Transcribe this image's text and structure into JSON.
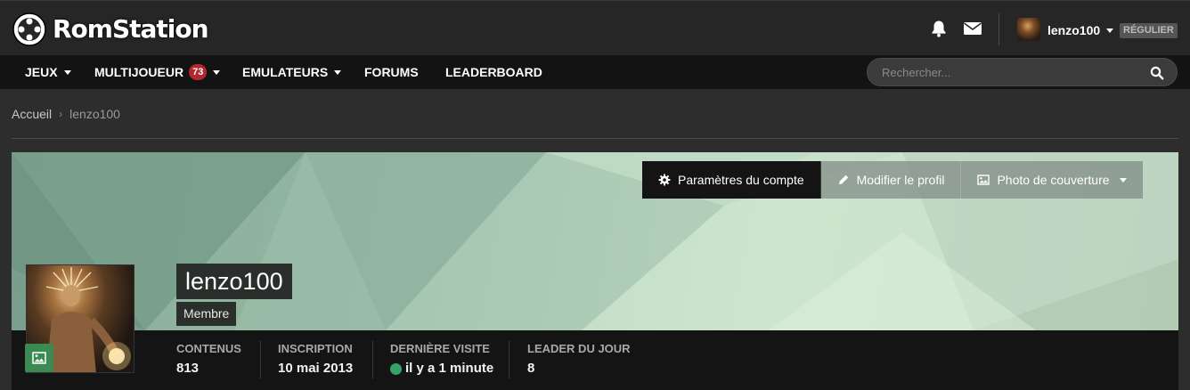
{
  "header": {
    "brand": "RomStation",
    "user_name": "lenzo100",
    "user_badge": "RÉGULIER"
  },
  "nav": {
    "items": [
      {
        "label": "JEUX",
        "has_dropdown": true
      },
      {
        "label": "MULTIJOUEUR",
        "badge": "73",
        "has_dropdown": true
      },
      {
        "label": "EMULATEURS",
        "has_dropdown": true
      },
      {
        "label": "FORUMS",
        "has_dropdown": false
      },
      {
        "label": "LEADERBOARD",
        "has_dropdown": false
      }
    ],
    "search_placeholder": "Rechercher..."
  },
  "breadcrumb": {
    "home": "Accueil",
    "current": "lenzo100"
  },
  "profile": {
    "name": "lenzo100",
    "role": "Membre",
    "actions": {
      "account_settings": "Paramètres du compte",
      "edit_profile": "Modifier le profil",
      "cover_photo": "Photo de couverture"
    },
    "stats": [
      {
        "label": "CONTENUS",
        "value": "813"
      },
      {
        "label": "INSCRIPTION",
        "value": "10 mai 2013"
      },
      {
        "label": "DERNIÈRE VISITE",
        "value": "il y a 1 minute"
      },
      {
        "label": "LEADER DU JOUR",
        "value": "8"
      }
    ]
  },
  "colors": {
    "accent_green": "#3a8a52",
    "badge_red": "#b3282d",
    "online": "#35a26a",
    "nav_bg": "#131313",
    "header_bg": "#262626"
  },
  "icons": {
    "logo": "gamepad-ring-icon",
    "notifications": "bell-icon",
    "messages": "envelope-icon",
    "search": "search-icon",
    "settings": "gear-icon",
    "edit": "pencil-icon",
    "cover": "image-icon"
  }
}
